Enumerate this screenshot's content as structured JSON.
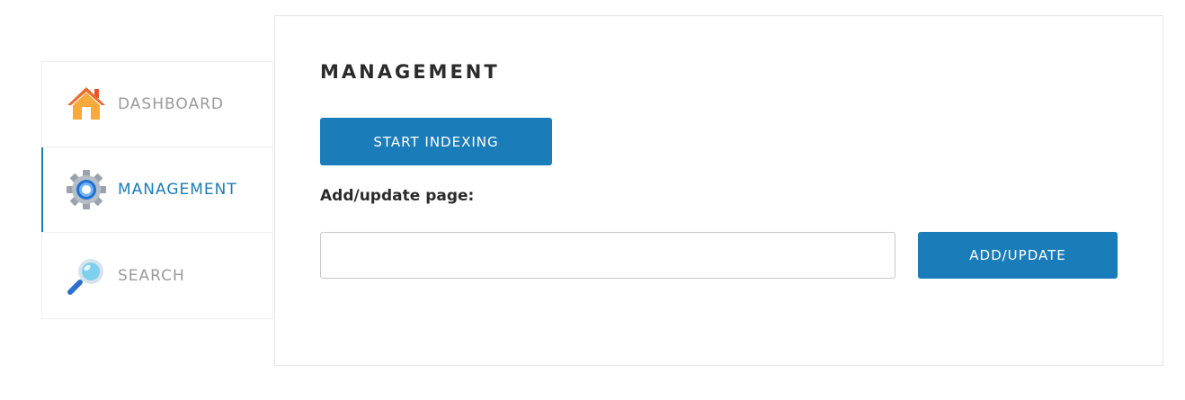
{
  "sidebar": {
    "items": [
      {
        "label": "DASHBOARD",
        "icon": "home-icon",
        "active": false
      },
      {
        "label": "MANAGEMENT",
        "icon": "gear-icon",
        "active": true
      },
      {
        "label": "SEARCH",
        "icon": "magnifier-icon",
        "active": false
      }
    ]
  },
  "main": {
    "title": "MANAGEMENT",
    "start_button_label": "START INDEXING",
    "field_label": "Add/update page:",
    "page_input_value": "",
    "page_input_placeholder": "",
    "add_button_label": "ADD/UPDATE"
  },
  "colors": {
    "accent": "#1a7cb8",
    "inactive_text": "#9a9a9a",
    "heading_text": "#2b2b2b"
  }
}
